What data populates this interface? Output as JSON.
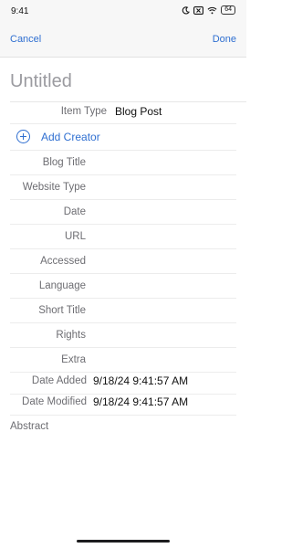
{
  "status": {
    "time": "9:41",
    "battery": "64"
  },
  "nav": {
    "cancel": "Cancel",
    "done": "Done"
  },
  "item": {
    "title": "Untitled",
    "item_type_label": "Item Type",
    "item_type_value": "Blog Post",
    "add_creator": "Add Creator",
    "fields": [
      "Blog Title",
      "Website Type",
      "Date",
      "URL",
      "Accessed",
      "Language",
      "Short Title",
      "Rights",
      "Extra"
    ],
    "date_added_label": "Date Added",
    "date_added_value": "9/18/24 9:41:57 AM",
    "date_modified_label": "Date Modified",
    "date_modified_value": "9/18/24 9:41:57 AM",
    "abstract_label": "Abstract"
  },
  "colors": {
    "accent": "#2f6fd1",
    "label": "#6d6d72",
    "placeholder": "#9b9ba0"
  }
}
